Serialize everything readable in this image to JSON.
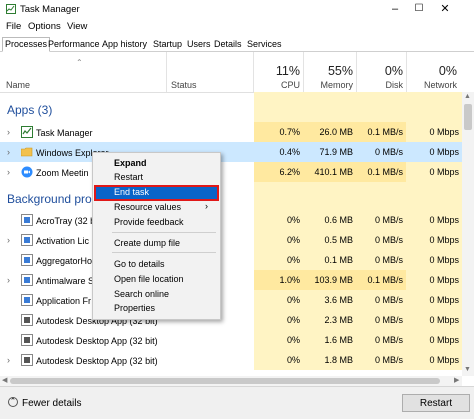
{
  "window": {
    "title": "Task Manager",
    "controls": [
      "–",
      "☐",
      "✕"
    ]
  },
  "menu": {
    "file": "File",
    "options": "Options",
    "view": "View"
  },
  "tabs": [
    "Processes",
    "Performance",
    "App history",
    "Startup",
    "Users",
    "Details",
    "Services"
  ],
  "header": {
    "name": "Name",
    "status": "Status",
    "cpu_pct": "11%",
    "cpu": "CPU",
    "mem_pct": "55%",
    "mem": "Memory",
    "disk_pct": "0%",
    "disk": "Disk",
    "net_pct": "0%",
    "net": "Network"
  },
  "groups": {
    "apps": "Apps (3)",
    "background": "Background pro"
  },
  "apps": [
    {
      "name": "Task Manager",
      "cpu": "0.7%",
      "mem": "26.0 MB",
      "disk": "0.1 MB/s",
      "net": "0 Mbps"
    },
    {
      "name": "Windows Explorer",
      "cpu": "0.4%",
      "mem": "71.9 MB",
      "disk": "0 MB/s",
      "net": "0 Mbps"
    },
    {
      "name": "Zoom Meetin",
      "cpu": "6.2%",
      "mem": "410.1 MB",
      "disk": "0.1 MB/s",
      "net": "0 Mbps"
    }
  ],
  "background": [
    {
      "name": "AcroTray (32 bi",
      "cpu": "0%",
      "mem": "0.6 MB",
      "disk": "0 MB/s",
      "net": "0 Mbps"
    },
    {
      "name": "Activation Lic",
      "cpu": "0%",
      "mem": "0.5 MB",
      "disk": "0 MB/s",
      "net": "0 Mbps"
    },
    {
      "name": "AggregatorHo",
      "cpu": "0%",
      "mem": "0.1 MB",
      "disk": "0 MB/s",
      "net": "0 Mbps"
    },
    {
      "name": "Antimalware S",
      "cpu": "1.0%",
      "mem": "103.9 MB",
      "disk": "0.1 MB/s",
      "net": "0 Mbps"
    },
    {
      "name": "Application Fr",
      "cpu": "0%",
      "mem": "3.6 MB",
      "disk": "0 MB/s",
      "net": "0 Mbps"
    },
    {
      "name": "Autodesk Desktop App (32 bit)",
      "cpu": "0%",
      "mem": "2.3 MB",
      "disk": "0 MB/s",
      "net": "0 Mbps"
    },
    {
      "name": "Autodesk Desktop App (32 bit)",
      "cpu": "0%",
      "mem": "1.6 MB",
      "disk": "0 MB/s",
      "net": "0 Mbps"
    },
    {
      "name": "Autodesk Desktop App (32 bit)",
      "cpu": "0%",
      "mem": "1.8 MB",
      "disk": "0 MB/s",
      "net": "0 Mbps"
    }
  ],
  "context_menu": {
    "expand": "Expand",
    "restart": "Restart",
    "end_task": "End task",
    "resource_values": "Resource values",
    "provide_feedback": "Provide feedback",
    "create_dump_file": "Create dump file",
    "go_to_details": "Go to details",
    "open_file_location": "Open file location",
    "search_online": "Search online",
    "properties": "Properties"
  },
  "footer": {
    "fewer_details": "Fewer details",
    "restart_button": "Restart"
  },
  "colors": {
    "heat_light": "#fff4c4",
    "heat_medium": "#ffe9a0",
    "selection": "#cce8ff",
    "menu_highlight": "#0a64c8",
    "annotation_box": "#e01818"
  }
}
